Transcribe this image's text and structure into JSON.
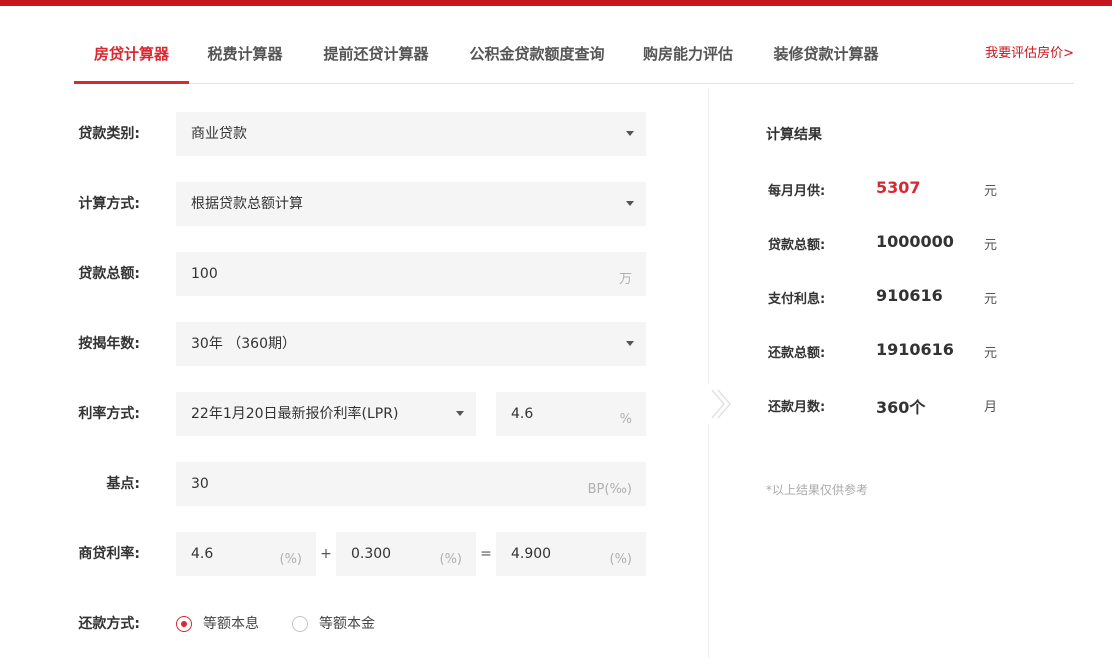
{
  "tabs": [
    {
      "label": "房贷计算器",
      "active": true
    },
    {
      "label": "税费计算器",
      "active": false
    },
    {
      "label": "提前还贷计算器",
      "active": false
    },
    {
      "label": "公积金贷款额度查询",
      "active": false
    },
    {
      "label": "购房能力评估",
      "active": false
    },
    {
      "label": "装修贷款计算器",
      "active": false
    }
  ],
  "top_link": "我要评估房价>",
  "form": {
    "loan_type": {
      "label": "贷款类别:",
      "value": "商业贷款"
    },
    "calc_method": {
      "label": "计算方式:",
      "value": "根据贷款总额计算"
    },
    "loan_total": {
      "label": "贷款总额:",
      "value": "100",
      "unit": "万"
    },
    "years": {
      "label": "按揭年数:",
      "value": "30年 （360期）"
    },
    "rate_method": {
      "label": "利率方式:",
      "value": "22年1月20日最新报价利率(LPR)",
      "rate": "4.6",
      "rate_unit": "%"
    },
    "bp": {
      "label": "基点:",
      "value": "30",
      "unit": "BP(‰)"
    },
    "commercial_rate": {
      "label": "商贷利率:",
      "base": "4.6",
      "plus": "+",
      "add": "0.300",
      "equals": "=",
      "result": "4.900",
      "unit": "(%)"
    },
    "repay_method": {
      "label": "还款方式:",
      "options": [
        {
          "label": "等额本息",
          "selected": true
        },
        {
          "label": "等额本金",
          "selected": false
        }
      ]
    }
  },
  "result": {
    "title": "计算结果",
    "rows": [
      {
        "label": "每月月供:",
        "value": "5307",
        "unit": "元",
        "highlight": true
      },
      {
        "label": "贷款总额:",
        "value": "1000000",
        "unit": "元",
        "highlight": false
      },
      {
        "label": "支付利息:",
        "value": "910616",
        "unit": "元",
        "highlight": false
      },
      {
        "label": "还款总额:",
        "value": "1910616",
        "unit": "元",
        "highlight": false
      },
      {
        "label": "还款月数:",
        "value": "360个",
        "unit": "月",
        "highlight": false
      }
    ],
    "note": "*以上结果仅供参考"
  },
  "colors": {
    "accent": "#d9282f",
    "topbar": "#c8161d",
    "field_bg": "#f5f5f5"
  },
  "icons": [
    "dropdown-caret-icon",
    "radio-icon",
    "chevron-right-icon"
  ]
}
